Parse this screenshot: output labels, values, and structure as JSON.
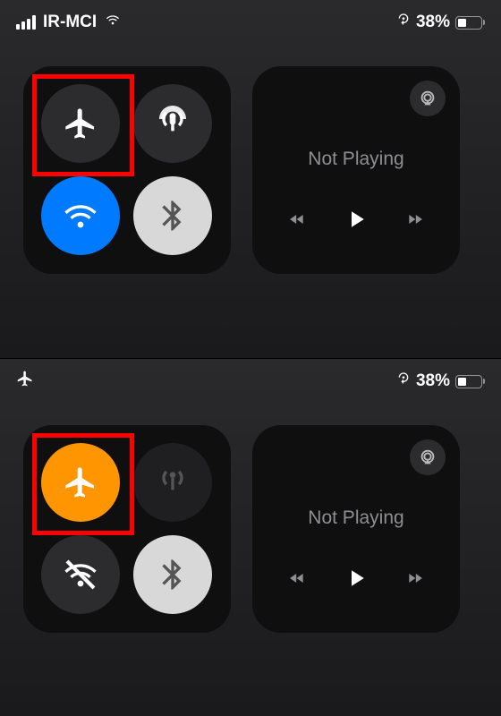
{
  "top": {
    "status": {
      "carrier": "IR-MCI",
      "battery_percent": "38%",
      "battery_fill_percent": 38,
      "signal_bars": 4
    },
    "connectivity": {
      "airplane": {
        "active": false
      },
      "cellular": {
        "active": true
      },
      "wifi": {
        "active": true
      },
      "bluetooth": {
        "active": true
      }
    },
    "media": {
      "status": "Not Playing"
    }
  },
  "bottom": {
    "status": {
      "airplane_mode": true,
      "battery_percent": "38%",
      "battery_fill_percent": 38
    },
    "connectivity": {
      "airplane": {
        "active": true
      },
      "cellular": {
        "active": false
      },
      "wifi": {
        "active": false
      },
      "bluetooth": {
        "active": true
      }
    },
    "media": {
      "status": "Not Playing"
    }
  },
  "colors": {
    "accent_blue": "#007aff",
    "accent_orange": "#ff9500",
    "highlight_red": "#ff0000"
  }
}
